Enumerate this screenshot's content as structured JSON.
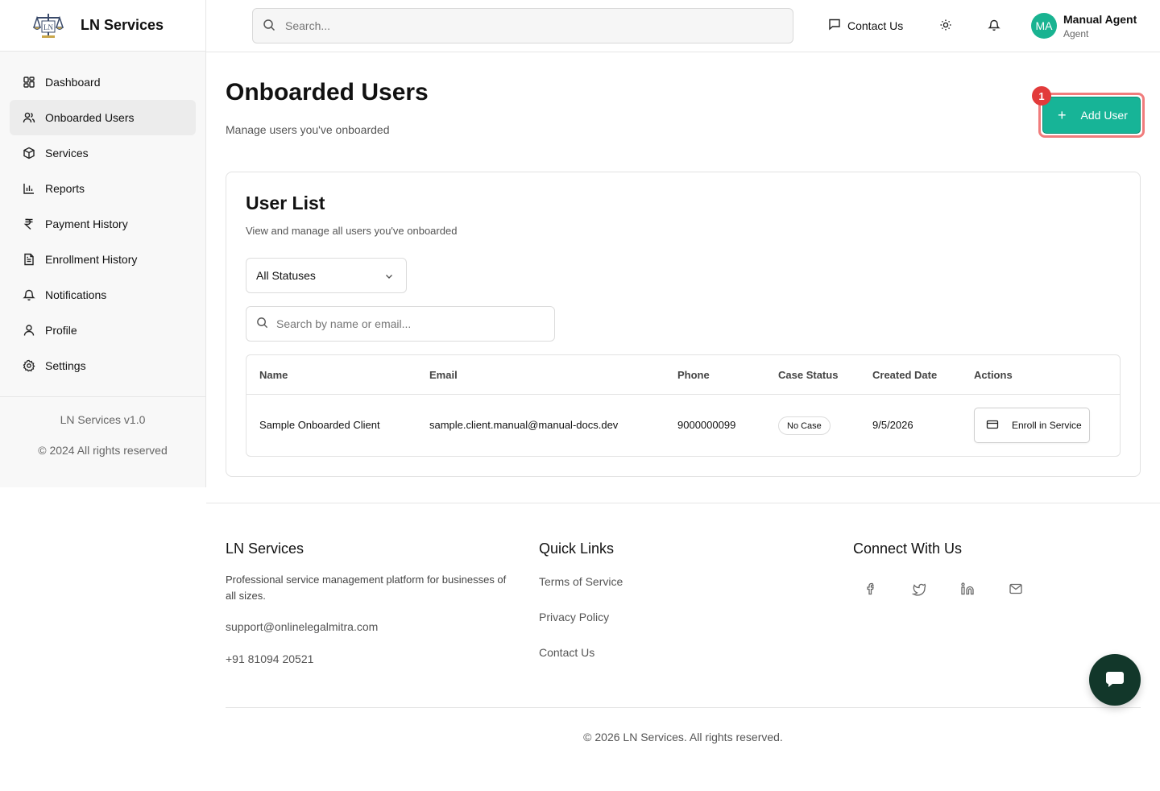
{
  "brand": {
    "name": "LN Services",
    "logo_icon": "scales-logo-icon"
  },
  "sidebar": {
    "items": [
      {
        "label": "Dashboard",
        "icon": "dashboard-icon",
        "active": false
      },
      {
        "label": "Onboarded Users",
        "icon": "users-icon",
        "active": true
      },
      {
        "label": "Services",
        "icon": "box-icon",
        "active": false
      },
      {
        "label": "Reports",
        "icon": "bar-chart-icon",
        "active": false
      },
      {
        "label": "Payment History",
        "icon": "rupee-icon",
        "active": false
      },
      {
        "label": "Enrollment History",
        "icon": "document-icon",
        "active": false
      },
      {
        "label": "Notifications",
        "icon": "bell-icon",
        "active": false
      },
      {
        "label": "Profile",
        "icon": "user-icon",
        "active": false
      },
      {
        "label": "Settings",
        "icon": "gear-icon",
        "active": false
      }
    ],
    "version": "LN Services v1.0",
    "copyright": "© 2024 All rights reserved"
  },
  "header": {
    "search_placeholder": "Search...",
    "contact_label": "Contact Us",
    "avatar_initials": "MA",
    "user_name": "Manual Agent",
    "user_role": "Agent"
  },
  "main": {
    "title": "Onboarded Users",
    "subtitle": "Manage users you've onboarded",
    "add_user_label": "Add User",
    "badge": "1"
  },
  "user_list": {
    "title": "User List",
    "subtitle": "View and manage all users you've onboarded",
    "status_filter": "All Statuses",
    "search_placeholder": "Search by name or email...",
    "columns": [
      "Name",
      "Email",
      "Phone",
      "Case Status",
      "Created Date",
      "Actions"
    ],
    "rows": [
      {
        "name": "Sample Onboarded Client",
        "email": "sample.client.manual@manual-docs.dev",
        "phone": "9000000099",
        "case_status": "No Case",
        "created": "9/5/2026",
        "action": "Enroll in Service"
      }
    ]
  },
  "footer": {
    "brand_title": "LN Services",
    "description": "Professional service management platform for businesses of all sizes.",
    "email": "support@onlinelegalmitra.com",
    "phone": "+91 81094 20521",
    "quick_links_title": "Quick Links",
    "quick_links": [
      "Terms of Service",
      "Privacy Policy",
      "Contact Us"
    ],
    "connect_title": "Connect With Us",
    "copyright": "© 2026 LN Services. All rights reserved."
  },
  "colors": {
    "accent": "#17b497",
    "highlight": "#f07c7c",
    "badge": "#e23b3b",
    "chat": "#12372a"
  }
}
